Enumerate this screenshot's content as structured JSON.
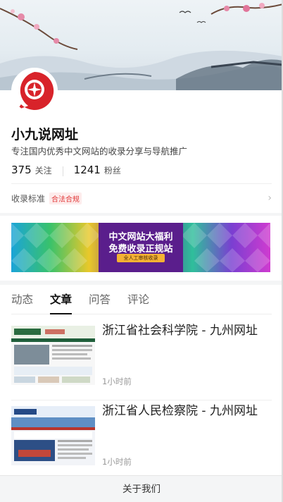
{
  "profile": {
    "name": "小九说网址",
    "description": "专注国内优秀中文网站的收录分享与导航推广",
    "following_count": "375",
    "following_label": "关注",
    "followers_count": "1241",
    "followers_label": "粉丝",
    "standard_label": "收录标准",
    "standard_badge": "合法合规"
  },
  "ad": {
    "line1": "中文网站大福利",
    "line2": "免费收录正规站",
    "note": "全人工审核收录"
  },
  "tabs": [
    {
      "label": "动态",
      "active": false
    },
    {
      "label": "文章",
      "active": true
    },
    {
      "label": "问答",
      "active": false
    },
    {
      "label": "评论",
      "active": false
    }
  ],
  "articles": [
    {
      "title": "浙江省社会科学院 - 九州网址",
      "time": "1小时前"
    },
    {
      "title": "浙江省人民检察院 - 九州网址",
      "time": "1小时前"
    }
  ],
  "footer": {
    "label": "关于我们"
  },
  "colors": {
    "accent_red": "#d8232a",
    "badge_red": "#e23b3b",
    "ad_purple": "#5a1e8c"
  }
}
